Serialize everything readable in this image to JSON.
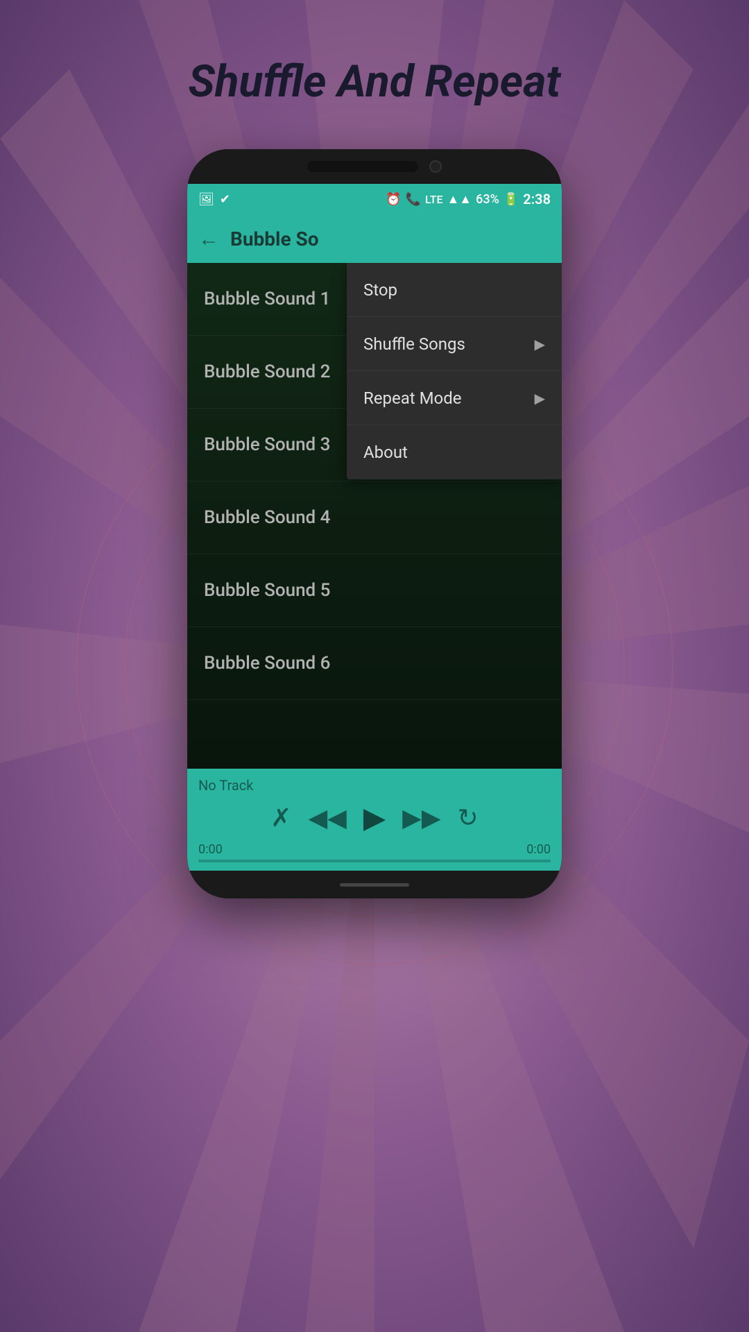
{
  "page": {
    "title": "Shuffle And Repeat",
    "background_color": "#8a5a90"
  },
  "status_bar": {
    "battery": "63%",
    "time": "2:38",
    "signal": "LTE",
    "battery_icon": "🔋"
  },
  "app_bar": {
    "title": "Bubble So",
    "back_label": "←"
  },
  "songs": [
    {
      "id": 1,
      "label": "Bubble Sound 1"
    },
    {
      "id": 2,
      "label": "Bubble Sound 2"
    },
    {
      "id": 3,
      "label": "Bubble Sound 3"
    },
    {
      "id": 4,
      "label": "Bubble Sound 4"
    },
    {
      "id": 5,
      "label": "Bubble Sound 5"
    },
    {
      "id": 6,
      "label": "Bubble Sound 6"
    }
  ],
  "dropdown": {
    "items": [
      {
        "id": "stop",
        "label": "Stop",
        "has_arrow": false
      },
      {
        "id": "shuffle",
        "label": "Shuffle Songs",
        "has_arrow": true
      },
      {
        "id": "repeat",
        "label": "Repeat Mode",
        "has_arrow": true
      },
      {
        "id": "about",
        "label": "About",
        "has_arrow": false
      }
    ]
  },
  "player": {
    "track_name": "No Track",
    "time_start": "0:00",
    "time_end": "0:00",
    "progress": 0
  }
}
